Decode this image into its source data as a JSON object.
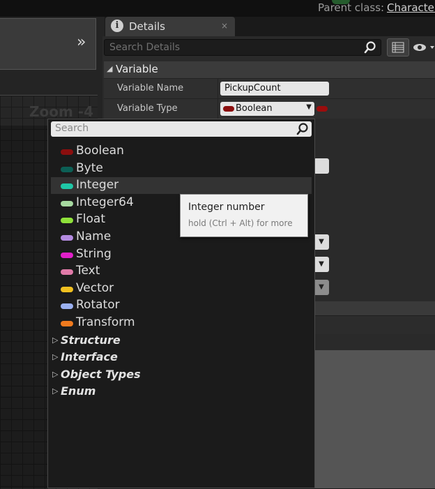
{
  "topbar": {
    "parent_label": "Parent class:",
    "parent_value": "Character"
  },
  "left": {
    "zoom_label": "Zoom -4",
    "collapse_icon": "double-chevron-right-icon"
  },
  "details": {
    "tab_title": "Details",
    "tab_close": "×",
    "search_placeholder": "Search Details",
    "section_title": "Variable",
    "rows": {
      "name_label": "Variable Name",
      "name_value": "PickupCount",
      "type_label": "Variable Type",
      "type_value": "Boolean",
      "type_color": "#8b0e0e"
    }
  },
  "dropdown": {
    "search_placeholder": "Search",
    "items": [
      {
        "label": "Boolean",
        "color": "#8b0e0e"
      },
      {
        "label": "Byte",
        "color": "#0c5f55"
      },
      {
        "label": "Integer",
        "color": "#1fc7a6"
      },
      {
        "label": "Integer64",
        "color": "#a6d9a0"
      },
      {
        "label": "Float",
        "color": "#8fe13a"
      },
      {
        "label": "Name",
        "color": "#b48be0"
      },
      {
        "label": "String",
        "color": "#e020c8"
      },
      {
        "label": "Text",
        "color": "#e07aa8"
      },
      {
        "label": "Vector",
        "color": "#f0c020"
      },
      {
        "label": "Rotator",
        "color": "#9ab0f0"
      },
      {
        "label": "Transform",
        "color": "#f07a1e"
      }
    ],
    "categories": [
      "Structure",
      "Interface",
      "Object Types",
      "Enum"
    ],
    "selected_index": 2
  },
  "tooltip": {
    "title": "Integer number",
    "hint": "hold (Ctrl + Alt) for more"
  }
}
